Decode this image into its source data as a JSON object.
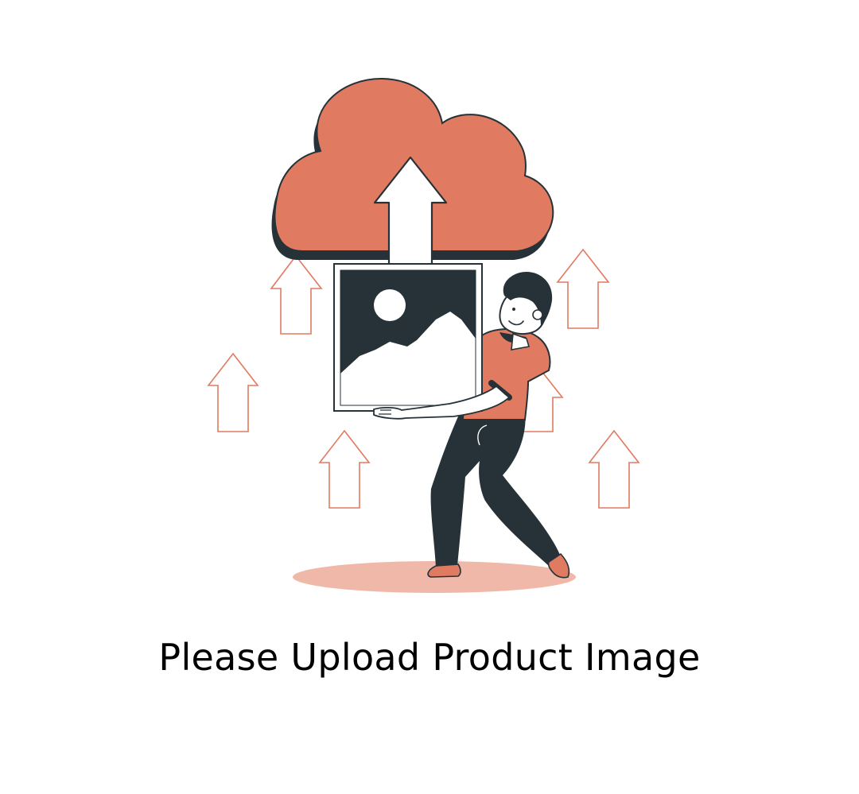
{
  "caption": "Please Upload Product Image",
  "icons": {
    "cloud": "cloud-upload-icon",
    "arrow": "up-arrow-icon",
    "picture": "image-placeholder-icon",
    "person": "person-carrying-image"
  },
  "colors": {
    "accent": "#E07B61",
    "dark": "#263238",
    "shadow": "#F0B8A9",
    "background": "#FFFFFF"
  }
}
